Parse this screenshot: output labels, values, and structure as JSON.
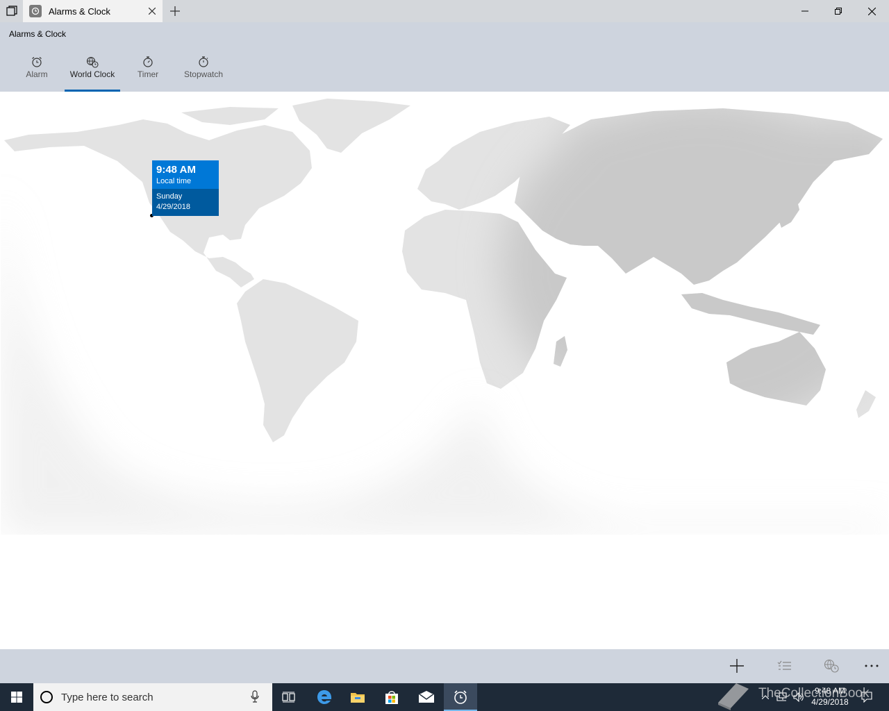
{
  "window": {
    "tab_title": "Alarms & Clock",
    "app_title": "Alarms & Clock"
  },
  "nav": {
    "items": [
      {
        "label": "Alarm",
        "icon": "alarm-icon"
      },
      {
        "label": "World Clock",
        "icon": "world-clock-icon"
      },
      {
        "label": "Timer",
        "icon": "timer-icon"
      },
      {
        "label": "Stopwatch",
        "icon": "stopwatch-icon"
      }
    ],
    "active": "World Clock"
  },
  "map": {
    "local_clock": {
      "time": "9:48 AM",
      "label": "Local time",
      "day": "Sunday",
      "date": "4/29/2018"
    }
  },
  "command_bar": {
    "buttons": [
      "add-icon",
      "select-icon",
      "compare-icon",
      "more-icon"
    ]
  },
  "taskbar": {
    "search_placeholder": "Type here to search",
    "pinned": [
      "task-view-icon",
      "edge-icon",
      "file-explorer-icon",
      "store-icon",
      "mail-icon",
      "alarms-app-icon"
    ],
    "clock_time": "9:48 AM",
    "clock_date": "4/29/2018"
  },
  "watermark": {
    "text": "TheCollectionBook"
  },
  "colors": {
    "accent": "#0078d7",
    "accent_dark": "#005a9e",
    "header_bg": "#ced4de",
    "land": "#e3e3e3",
    "night_shade": "#c9c9c9",
    "taskbar_bg": "#1e2a38"
  }
}
